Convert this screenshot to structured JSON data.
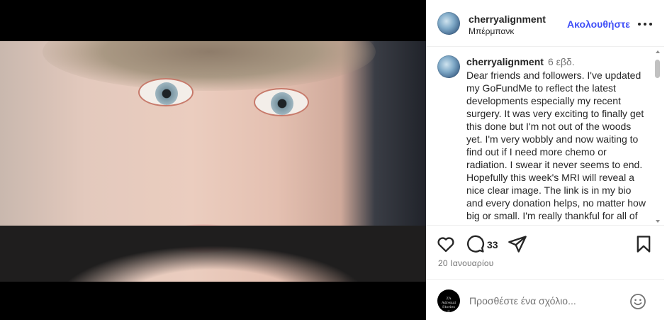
{
  "post": {
    "username": "cherryalignment",
    "location": "Μπέρμπανκ",
    "follow_label": "Ακολουθήστε",
    "time_ago": "6 εβδ.",
    "caption": "Dear friends and followers. I've updated my GoFundMe to reflect the latest developments especially my recent surgery. It was very exciting to finally get this done but I'm not out of the woods yet. I'm very wobbly and now waiting to find out if I need more chemo or radiation. I swear it never seems to end. Hopefully this week's MRI will reveal a nice clear image. The link is in my bio and every donation helps, no matter how big or small. I'm really thankful for all of you",
    "comment_count": "33",
    "date": "20 Ιανουαρίου"
  },
  "comment_box": {
    "placeholder": "Προσθέστε ένα σχόλιο..."
  },
  "icons": {
    "more": "more-options-icon",
    "like": "heart-icon",
    "comment": "comment-bubble-icon",
    "share": "paper-plane-icon",
    "save": "bookmark-icon",
    "emoji": "smiley-icon"
  },
  "colors": {
    "follow": "#4150f7",
    "text": "#262626",
    "muted": "#737373"
  }
}
